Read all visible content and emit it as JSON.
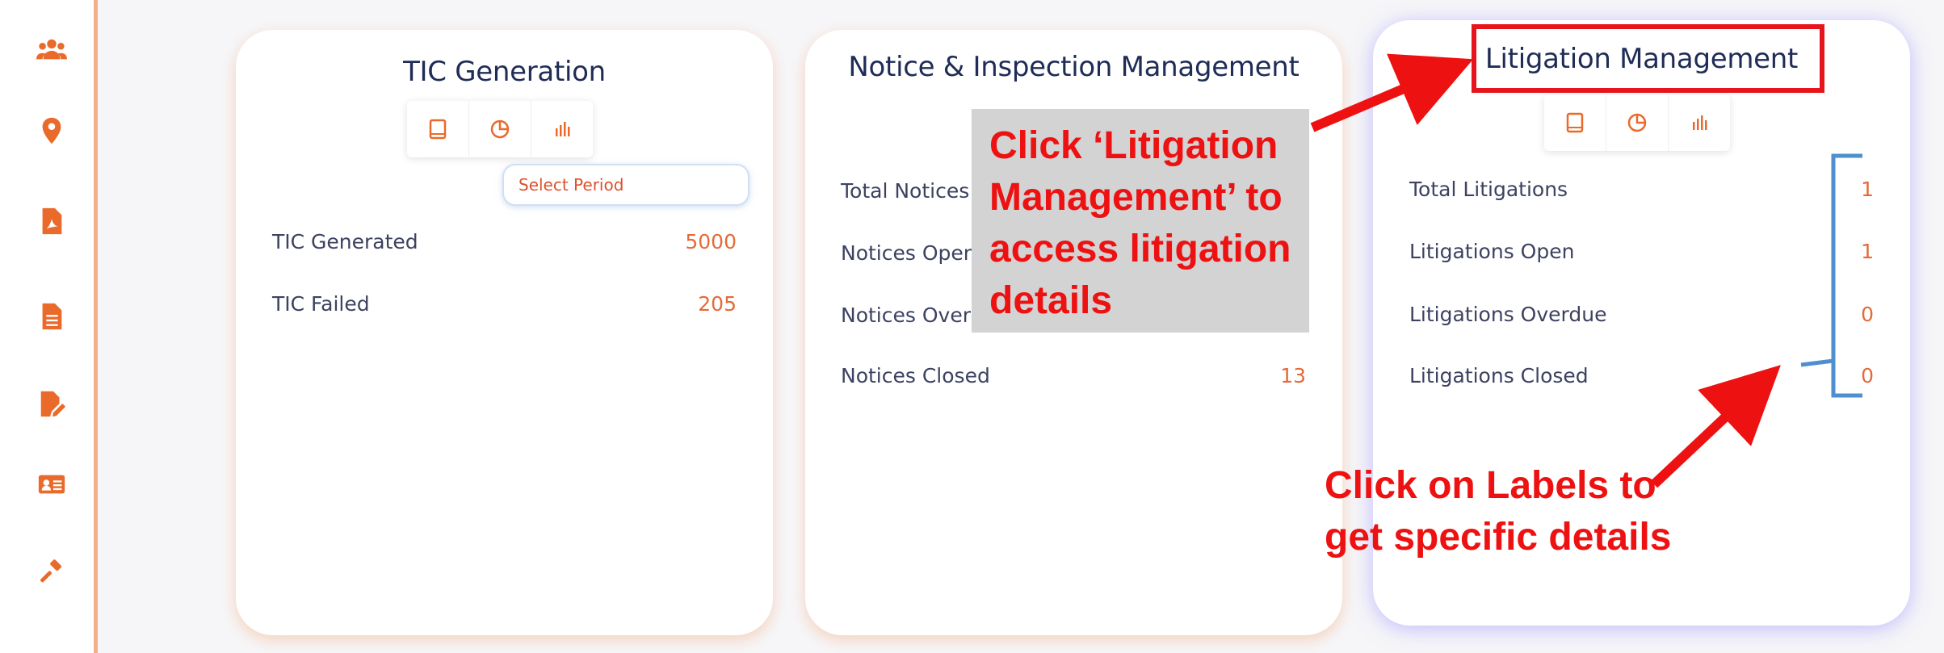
{
  "sidebar": {
    "icons": [
      "users-icon",
      "location-pin-icon",
      "pdf-document-icon",
      "document-icon",
      "edit-document-icon",
      "id-card-icon",
      "gavel-icon"
    ]
  },
  "cards": [
    {
      "title": "TIC Generation",
      "select_period": "Select Period",
      "rows": [
        {
          "label": "TIC Generated",
          "value": "5000"
        },
        {
          "label": "TIC Failed",
          "value": "205"
        }
      ]
    },
    {
      "title": "Notice & Inspection Management",
      "rows": [
        {
          "label": "Total Notices",
          "value": ""
        },
        {
          "label": "Notices Open",
          "value": ""
        },
        {
          "label": "Notices Overdue",
          "value": ""
        },
        {
          "label": "Notices Closed",
          "value": "13"
        }
      ]
    },
    {
      "title": "Litigation Management",
      "rows": [
        {
          "label": "Total Litigations",
          "value": "1"
        },
        {
          "label": "Litigations Open",
          "value": "1"
        },
        {
          "label": "Litigations Overdue",
          "value": "0"
        },
        {
          "label": "Litigations Closed",
          "value": "0"
        }
      ]
    }
  ],
  "annotations": {
    "callout_text": "Click ‘Litigation Management’ to access litigation details",
    "callout_lines": [
      "Click ‘Litigation",
      "Management’ to",
      "access litigation",
      "details"
    ],
    "hint_lines": [
      "Click on Labels to",
      "get specific details"
    ]
  },
  "colors": {
    "accent": "#e96a2b",
    "title": "#1f2c56",
    "value": "#e46a38",
    "annotation": "#ee1111",
    "bracket": "#4f8fd0"
  }
}
